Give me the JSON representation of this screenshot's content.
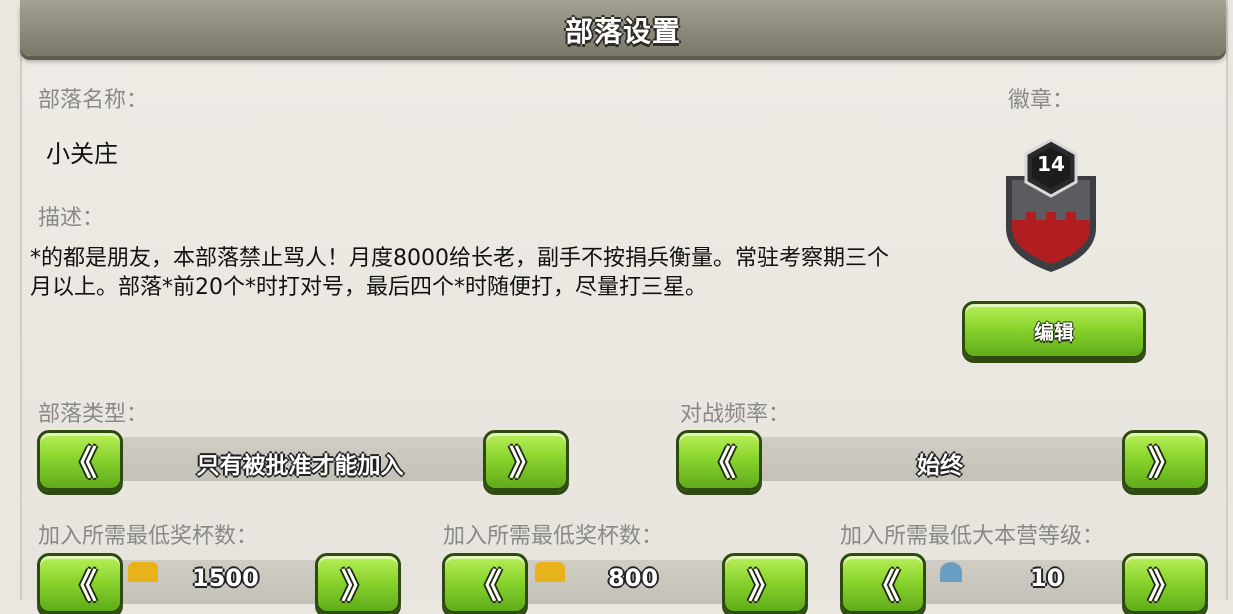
{
  "title": "部落设置",
  "name": {
    "label": "部落名称：",
    "value": "小关庄"
  },
  "badge": {
    "label": "徽章：",
    "level": "14",
    "edit_label": "编辑"
  },
  "description": {
    "label": "描述：",
    "text": "*的都是朋友，本部落禁止骂人！月度8000给长老，副手不按捐兵衡量。常驻考察期三个月以上。部落*前20个*时打对号，最后四个*时随便打，尽量打三星。"
  },
  "clan_type": {
    "label": "部落类型：",
    "value": "只有被批准才能加入"
  },
  "war_frequency": {
    "label": "对战频率：",
    "value": "始终"
  },
  "min_trophies": {
    "label": "加入所需最低奖杯数：",
    "value": "1500"
  },
  "min_builder_trophies": {
    "label": "加入所需最低奖杯数：",
    "value": "800"
  },
  "min_townhall": {
    "label": "加入所需最低大本营等级：",
    "value": "10"
  },
  "arrows": {
    "left": "《",
    "right": "》"
  },
  "colors": {
    "button_green": "#8bd52e",
    "badge_red": "#b01e22",
    "badge_gray": "#4b4d50"
  },
  "icons": [
    "trophy-icon",
    "builder-trophy-icon",
    "townhall-icon"
  ]
}
